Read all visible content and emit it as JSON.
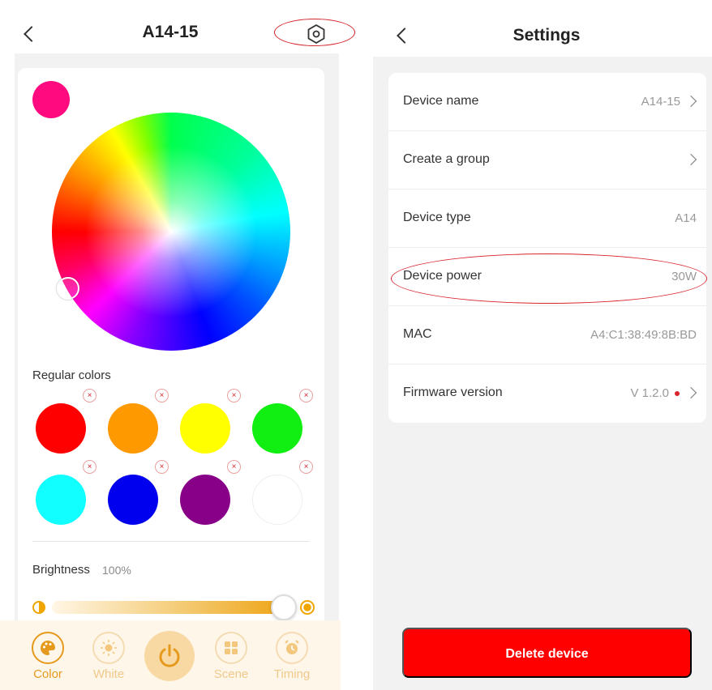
{
  "light_screen": {
    "title": "A14-15",
    "current_color": "#ff0a7f",
    "regular_colors_label": "Regular colors",
    "regular_colors": [
      "#ff0000",
      "#ff9900",
      "#ffff00",
      "#11ee11",
      "#11ffff",
      "#0000ee",
      "#880088",
      "#ffffff"
    ],
    "remove_glyph": "×",
    "brightness_label": "Brightness",
    "brightness_value": "100%",
    "brightness_level": 1.0,
    "tabs": [
      {
        "label": "Color",
        "icon": "palette-icon",
        "active": true
      },
      {
        "label": "White",
        "icon": "sun-icon",
        "active": false
      },
      {
        "label": "Scene",
        "icon": "scene-grid-icon",
        "active": false
      },
      {
        "label": "Timing",
        "icon": "alarm-clock-icon",
        "active": false
      }
    ]
  },
  "settings_screen": {
    "title": "Settings",
    "rows": [
      {
        "label": "Device name",
        "value": "A14-15",
        "arrow": true
      },
      {
        "label": "Create a group",
        "value": "",
        "arrow": true
      },
      {
        "label": "Device type",
        "value": "A14",
        "arrow": false
      },
      {
        "label": "Device power",
        "value": "30W",
        "arrow": false
      },
      {
        "label": "MAC",
        "value": "A4:C1:38:49:8B:BD",
        "arrow": false
      },
      {
        "label": "Firmware version",
        "value": "V 1.2.0",
        "arrow": true,
        "update_dot": true
      }
    ],
    "delete_label": "Delete device"
  },
  "colors": {
    "accent": "#e59a1e",
    "danger": "#ff0000",
    "annotation": "#d8242b"
  }
}
